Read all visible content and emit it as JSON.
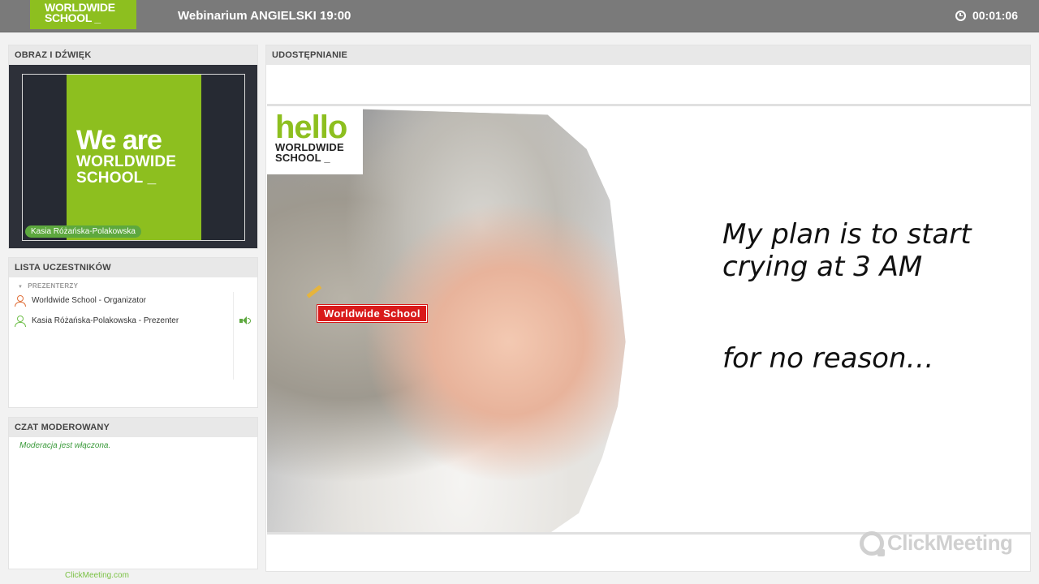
{
  "header": {
    "logo_line1": "WORLDWIDE",
    "logo_line2": "SCHOOL _",
    "title": "Webinarium ANGIELSKI 19:00",
    "timer": "00:01:06"
  },
  "video_panel": {
    "heading": "OBRAZ I DŹWIĘK",
    "card_line1": "We are",
    "card_line2": "WORLDWIDE",
    "card_line3": "SCHOOL _",
    "speaker_name": "Kasia Różańska-Polakowska"
  },
  "participants_panel": {
    "heading": "LISTA UCZESTNIKÓW",
    "group_label": "PREZENTERZY",
    "items": [
      {
        "label": "Worldwide School  - Organizator",
        "icon": "organizer-icon"
      },
      {
        "label": "Kasia Różańska-Polakowska  - Prezenter",
        "icon": "presenter-icon"
      }
    ]
  },
  "chat_panel": {
    "heading": "CZAT MODEROWANY",
    "message": "Moderacja jest włączona."
  },
  "share_panel": {
    "heading": "UDOSTĘPNIANIE",
    "slide": {
      "logo_hello": "hello",
      "logo_line1": "WORLDWIDE",
      "logo_line2": "SCHOOL _",
      "tag": "Worldwide School",
      "text_line1": "My plan is to start",
      "text_line2": "crying at 3 AM",
      "text_line3": "for no reason…"
    },
    "watermark": "ClickMeeting"
  },
  "footer": {
    "link": "ClickMeeting.com"
  },
  "colors": {
    "brand_green": "#8dbf1f",
    "topbar": "#7a7a7a",
    "tag_red": "#d91a1a"
  }
}
